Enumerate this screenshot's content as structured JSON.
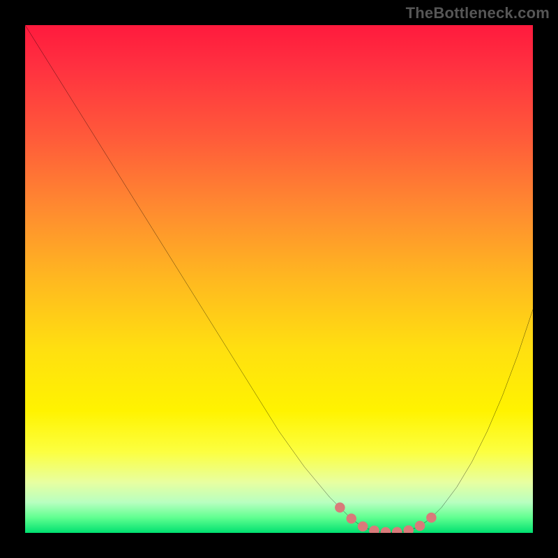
{
  "attribution": "TheBottleneck.com",
  "chart_data": {
    "type": "line",
    "title": "",
    "xlabel": "",
    "ylabel": "",
    "xlim": [
      0,
      100
    ],
    "ylim": [
      0,
      100
    ],
    "x": [
      0,
      5,
      10,
      15,
      20,
      25,
      30,
      35,
      40,
      45,
      50,
      55,
      60,
      62,
      64,
      66,
      68,
      70,
      72,
      74,
      76,
      78,
      80,
      82,
      85,
      88,
      91,
      94,
      97,
      100
    ],
    "y": [
      100,
      92,
      84,
      76,
      68,
      60,
      52,
      44,
      36,
      28,
      20,
      13,
      7,
      5,
      3,
      1.5,
      0.6,
      0.2,
      0.1,
      0.2,
      0.6,
      1.5,
      3,
      5,
      9,
      14,
      20,
      27,
      35,
      44
    ],
    "optimal_band": {
      "x_start": 62,
      "x_end": 80
    },
    "marker_color": "#d97a7a",
    "line_color": "#000000"
  }
}
